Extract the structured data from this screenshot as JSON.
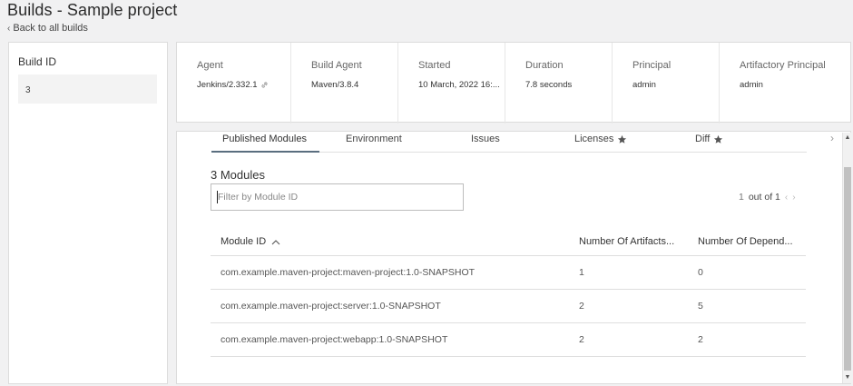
{
  "page": {
    "title": "Builds - Sample project",
    "back_label": "Back to all builds"
  },
  "left_panel": {
    "title": "Build ID",
    "items": [
      {
        "label": "3"
      }
    ]
  },
  "info": [
    {
      "label": "Agent",
      "value": "Jenkins/2.332.1"
    },
    {
      "label": "Build Agent",
      "value": "Maven/3.8.4"
    },
    {
      "label": "Started",
      "value": "10 March, 2022 16:..."
    },
    {
      "label": "Duration",
      "value": "7.8 seconds"
    },
    {
      "label": "Principal",
      "value": "admin"
    },
    {
      "label": "Artifactory Principal",
      "value": "admin"
    }
  ],
  "tabs": [
    {
      "label": "Published Modules",
      "active": true
    },
    {
      "label": "Environment"
    },
    {
      "label": "Issues"
    },
    {
      "label": "Licenses",
      "icon": "star-icon"
    },
    {
      "label": "Diff",
      "icon": "star-icon"
    }
  ],
  "modules": {
    "count_label": "3 Modules",
    "filter_placeholder": "Filter by Module ID",
    "pager": {
      "current": "1",
      "total_label": "out of 1"
    },
    "columns": [
      "Module ID",
      "Number Of Artifacts...",
      "Number Of Depend..."
    ],
    "rows": [
      [
        "com.example.maven-project:maven-project:1.0-SNAPSHOT",
        "1",
        "0"
      ],
      [
        "com.example.maven-project:server:1.0-SNAPSHOT",
        "2",
        "5"
      ],
      [
        "com.example.maven-project:webapp:1.0-SNAPSHOT",
        "2",
        "2"
      ]
    ]
  }
}
